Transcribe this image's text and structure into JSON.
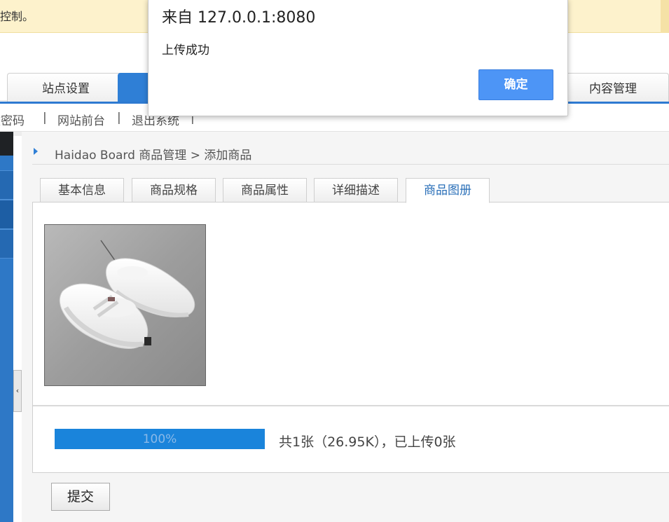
{
  "banner": {
    "text": "控制。"
  },
  "nav": {
    "tabs": [
      {
        "label": "站点设置"
      },
      {
        "label": ""
      },
      {
        "label": "内容管理"
      }
    ]
  },
  "toplinks": {
    "change_password": "改密码",
    "site_front": "网站前台",
    "logout": "退出系统",
    "separator": "|"
  },
  "sidebar": {
    "collapse_arrow": "‹"
  },
  "breadcrumb": {
    "text": "Haidao Board 商品管理 > 添加商品"
  },
  "subtabs": [
    {
      "label": "基本信息"
    },
    {
      "label": "商品规格"
    },
    {
      "label": "商品属性"
    },
    {
      "label": "详细描述"
    },
    {
      "label": "商品图册"
    }
  ],
  "upload": {
    "image_alt": "white sneakers photo",
    "progress_percent": 100,
    "progress_label": "100%",
    "summary": "共1张（26.95K），已上传0张"
  },
  "form": {
    "submit_label": "提交"
  },
  "dialog": {
    "title": "来自 127.0.0.1:8080",
    "message": "上传成功",
    "ok_label": "确定"
  },
  "colors": {
    "accent": "#2f7fd6",
    "progress": "#1a84db",
    "dialog_button": "#4d95f6",
    "banner_bg": "#fdf2cc"
  }
}
